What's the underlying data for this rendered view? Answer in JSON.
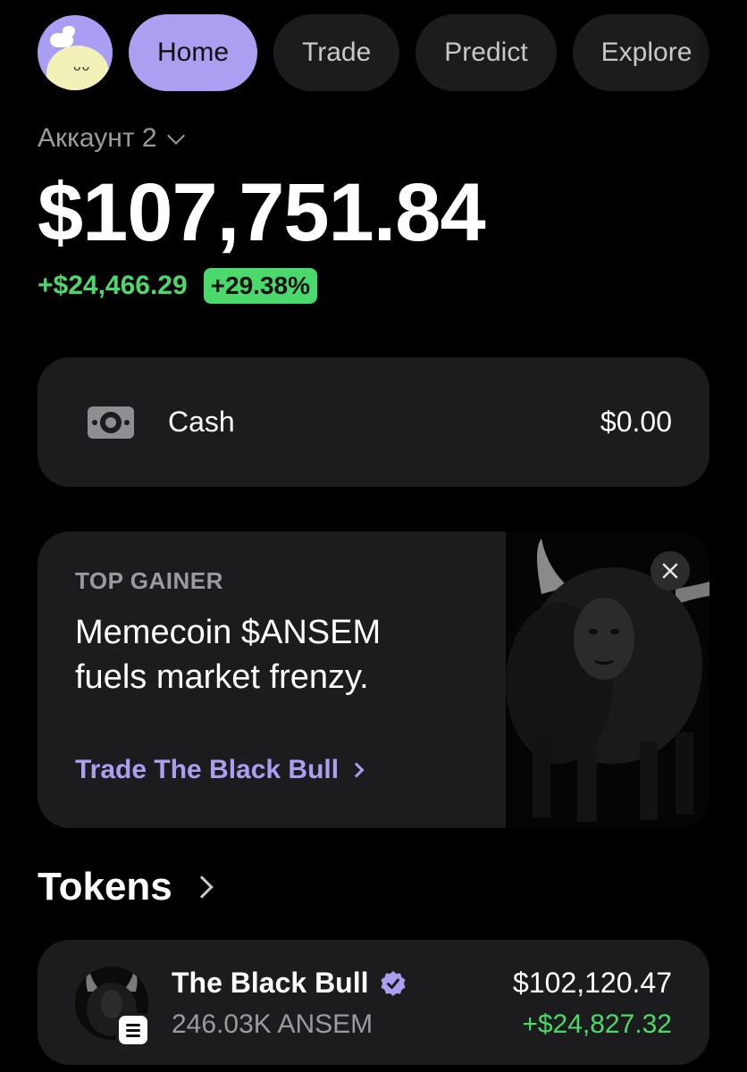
{
  "nav": {
    "tabs": [
      {
        "label": "Home",
        "active": true
      },
      {
        "label": "Trade",
        "active": false
      },
      {
        "label": "Predict",
        "active": false
      },
      {
        "label": "Explore",
        "active": false
      }
    ]
  },
  "account": {
    "name": "Аккаунт 2",
    "balance": "$107,751.84",
    "change_abs": "+$24,466.29",
    "change_pct": "+29.38%"
  },
  "cash": {
    "icon": "cash-icon",
    "label": "Cash",
    "value": "$0.00"
  },
  "promo": {
    "eyebrow": "TOP GAINER",
    "title": "Memecoin $ANSEM fuels market frenzy.",
    "link": "Trade The Black Bull"
  },
  "tokens": {
    "heading": "Tokens",
    "items": [
      {
        "name": "The Black Bull",
        "amount": "246.03K ANSEM",
        "value": "$102,120.47",
        "pnl": "+$24,827.32",
        "verified": true
      }
    ]
  },
  "colors": {
    "accent": "#ab9ff2",
    "positive": "#4ad96a",
    "card": "#1c1c1e",
    "background": "#000000"
  }
}
